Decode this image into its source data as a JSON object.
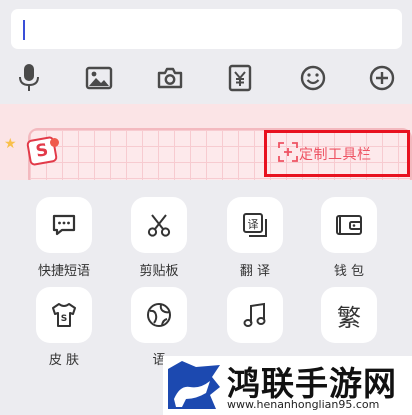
{
  "input": {
    "value": ""
  },
  "toolbar": {
    "icons": [
      "microphone-icon",
      "image-icon",
      "camera-icon",
      "wallet-yuan-icon",
      "smiley-icon",
      "plus-circle-icon"
    ]
  },
  "banner": {
    "badge_text": "S",
    "customize_label": "定制工具栏"
  },
  "tools": [
    {
      "label": "快捷短语",
      "icon": "quick-phrase-icon"
    },
    {
      "label": "剪贴板",
      "icon": "scissors-icon"
    },
    {
      "label": "翻 译",
      "icon": "translate-icon"
    },
    {
      "label": "钱 包",
      "icon": "wallet-icon"
    },
    {
      "label": "皮 肤",
      "icon": "tshirt-skin-icon"
    },
    {
      "label": "语",
      "icon": "globe-icon"
    },
    {
      "label": "",
      "icon": "music-note-icon"
    },
    {
      "label": "",
      "icon": "traditional-chinese-icon",
      "glyph": "繁"
    }
  ],
  "watermark": {
    "title": "鸿联手游网",
    "url": "www.henanhonglian95.com"
  },
  "colors": {
    "background": "#ececf0",
    "accent_blue": "#3a4fd8",
    "highlight_red": "#e8111f",
    "banner_pink": "#fbe4e6",
    "label_pink": "#ee5363"
  }
}
